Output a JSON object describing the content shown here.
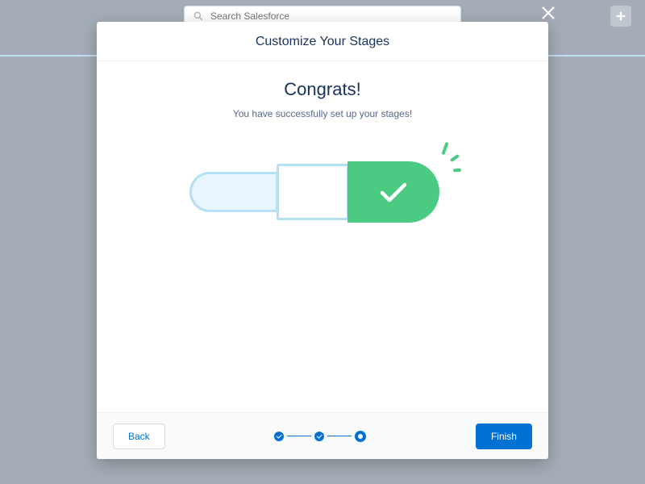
{
  "search": {
    "placeholder": "Search Salesforce"
  },
  "modal": {
    "title": "Customize Your Stages",
    "heading": "Congrats!",
    "subtext": "You have successfully set up your stages!",
    "back_label": "Back",
    "finish_label": "Finish"
  },
  "steps": {
    "count": 3,
    "current": 3
  },
  "colors": {
    "brand": "#0070d2",
    "success": "#4bca81"
  }
}
